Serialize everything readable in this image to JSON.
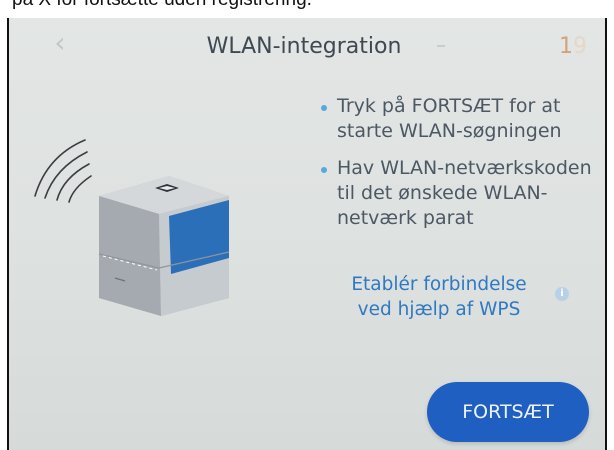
{
  "caption": {
    "text": "på X for fortsætte uden registrering."
  },
  "header": {
    "back_icon": "chevron-left-icon",
    "title": "WLAN-integration",
    "page_current": "1",
    "page_total": "9"
  },
  "instructions": {
    "items": [
      {
        "text": "Tryk på FORTSÆT for at starte WLAN-søgningen"
      },
      {
        "text": "Hav WLAN-netværkskoden til det ønskede WLAN-netværk parat"
      }
    ]
  },
  "wps": {
    "link_text": "Etablér forbindelse ved hjælp af WPS",
    "info_icon": "info-icon"
  },
  "actions": {
    "continue_label": "FORTSÆT"
  },
  "colors": {
    "screen_bg": "#e0e3e1",
    "title": "#3e4953",
    "body_text": "#4c5864",
    "bullet": "#5aa8da",
    "link": "#2f79c3",
    "button": "#1f5fc2",
    "pager_current": "#d2a37a"
  }
}
